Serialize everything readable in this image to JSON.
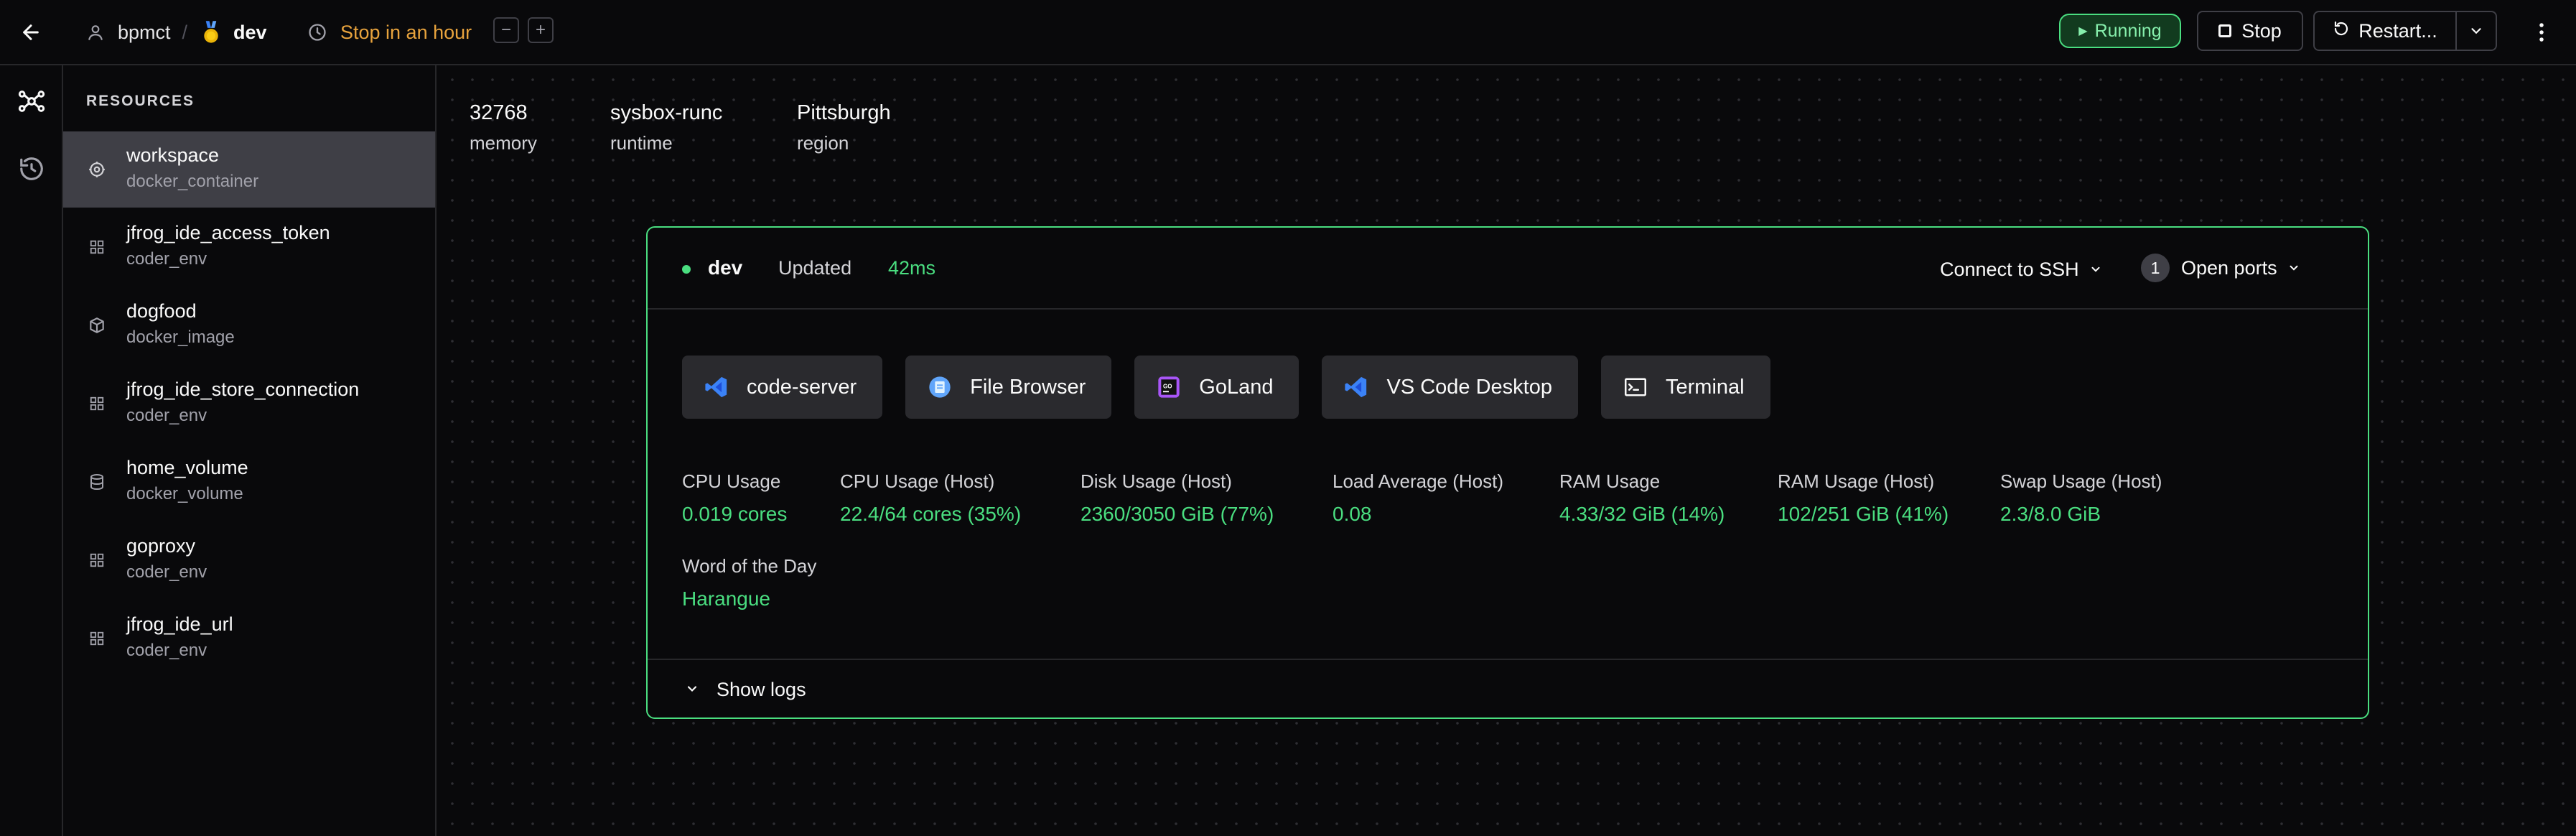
{
  "header": {
    "owner": "bpmct",
    "separator": "/",
    "workspace": "dev",
    "schedule_label": "Stop in an hour",
    "decrease_label": "−",
    "increase_label": "+",
    "status_label": "Running",
    "stop_label": "Stop",
    "restart_label": "Restart...",
    "status_color": "#4ade80",
    "schedule_color": "#e8a33d"
  },
  "sidebar": {
    "heading": "RESOURCES",
    "items": [
      {
        "name": "workspace",
        "type": "docker_container",
        "icon": "container-icon"
      },
      {
        "name": "jfrog_ide_access_token",
        "type": "coder_env",
        "icon": "grid-icon"
      },
      {
        "name": "dogfood",
        "type": "docker_image",
        "icon": "package-icon"
      },
      {
        "name": "jfrog_ide_store_connection",
        "type": "coder_env",
        "icon": "grid-icon"
      },
      {
        "name": "home_volume",
        "type": "docker_volume",
        "icon": "database-icon"
      },
      {
        "name": "goproxy",
        "type": "coder_env",
        "icon": "grid-icon"
      },
      {
        "name": "jfrog_ide_url",
        "type": "coder_env",
        "icon": "grid-icon"
      }
    ]
  },
  "resource_meta": [
    {
      "value": "32768",
      "label": "memory"
    },
    {
      "value": "sysbox-runc",
      "label": "runtime"
    },
    {
      "value": "Pittsburgh",
      "label": "region"
    }
  ],
  "agent": {
    "name": "dev",
    "updated_label": "Updated",
    "latency": "42ms",
    "ssh_label": "Connect to SSH",
    "ports_count": "1",
    "ports_label": "Open ports",
    "apps": [
      {
        "label": "code-server",
        "icon": "vscode-icon"
      },
      {
        "label": "File Browser",
        "icon": "file-browser-icon"
      },
      {
        "label": "GoLand",
        "icon": "goland-icon"
      },
      {
        "label": "VS Code Desktop",
        "icon": "vscode-icon"
      },
      {
        "label": "Terminal",
        "icon": "terminal-icon"
      }
    ],
    "stats": [
      {
        "label": "CPU Usage",
        "value": "0.019 cores"
      },
      {
        "label": "CPU Usage (Host)",
        "value": "22.4/64 cores (35%)"
      },
      {
        "label": "Disk Usage (Host)",
        "value": "2360/3050 GiB (77%)"
      },
      {
        "label": "Load Average (Host)",
        "value": "0.08"
      },
      {
        "label": "RAM Usage",
        "value": "4.33/32 GiB (14%)"
      },
      {
        "label": "RAM Usage (Host)",
        "value": "102/251 GiB (41%)"
      },
      {
        "label": "Swap Usage (Host)",
        "value": "2.3/8.0 GiB"
      },
      {
        "label": "Word of the Day",
        "value": "Harangue"
      }
    ],
    "logs_label": "Show logs"
  }
}
